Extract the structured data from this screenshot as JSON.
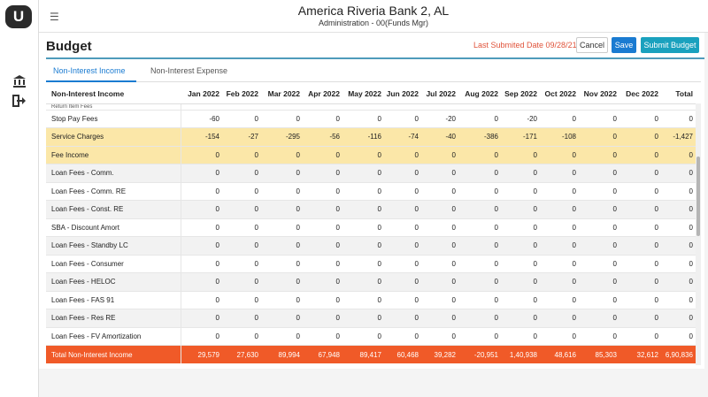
{
  "app": {
    "logo": "U"
  },
  "header": {
    "bank_name": "America Riveria Bank 2, AL",
    "subtitle": "Administration - 00(Funds Mgr)"
  },
  "page": {
    "title": "Budget",
    "last_submitted": "Last Submited Date 09/28/21",
    "cancel_label": "Cancel",
    "save_label": "Save",
    "submit_label": "Submit Budget"
  },
  "tabs": [
    {
      "label": "Non-Interest Income",
      "active": true
    },
    {
      "label": "Non-Interest Expense",
      "active": false
    }
  ],
  "table": {
    "columns": [
      "Non-Interest Income",
      "Jan 2022",
      "Feb 2022",
      "Mar 2022",
      "Apr 2022",
      "May 2022",
      "Jun 2022",
      "Jul 2022",
      "Aug 2022",
      "Sep 2022",
      "Oct 2022",
      "Nov 2022",
      "Dec 2022",
      "Total"
    ],
    "partial_row_label": "Return Item Fees",
    "rows": [
      {
        "label": "Stop Pay Fees",
        "values": [
          "-60",
          "0",
          "0",
          "0",
          "0",
          "0",
          "-20",
          "0",
          "-20",
          "0",
          "0",
          "0",
          "0"
        ],
        "highlight": false
      },
      {
        "label": "Service Charges",
        "values": [
          "-154",
          "-27",
          "-295",
          "-56",
          "-116",
          "-74",
          "-40",
          "-386",
          "-171",
          "-108",
          "0",
          "0",
          "-1,427"
        ],
        "highlight": true
      },
      {
        "label": "Fee Income",
        "values": [
          "0",
          "0",
          "0",
          "0",
          "0",
          "0",
          "0",
          "0",
          "0",
          "0",
          "0",
          "0",
          "0"
        ],
        "highlight": true
      },
      {
        "label": "Loan Fees - Comm.",
        "values": [
          "0",
          "0",
          "0",
          "0",
          "0",
          "0",
          "0",
          "0",
          "0",
          "0",
          "0",
          "0",
          "0"
        ],
        "highlight": false
      },
      {
        "label": "Loan Fees - Comm. RE",
        "values": [
          "0",
          "0",
          "0",
          "0",
          "0",
          "0",
          "0",
          "0",
          "0",
          "0",
          "0",
          "0",
          "0"
        ],
        "highlight": false
      },
      {
        "label": "Loan Fees - Const. RE",
        "values": [
          "0",
          "0",
          "0",
          "0",
          "0",
          "0",
          "0",
          "0",
          "0",
          "0",
          "0",
          "0",
          "0"
        ],
        "highlight": false
      },
      {
        "label": "SBA - Discount Amort",
        "values": [
          "0",
          "0",
          "0",
          "0",
          "0",
          "0",
          "0",
          "0",
          "0",
          "0",
          "0",
          "0",
          "0"
        ],
        "highlight": false
      },
      {
        "label": "Loan Fees - Standby LC",
        "values": [
          "0",
          "0",
          "0",
          "0",
          "0",
          "0",
          "0",
          "0",
          "0",
          "0",
          "0",
          "0",
          "0"
        ],
        "highlight": false
      },
      {
        "label": "Loan Fees - Consumer",
        "values": [
          "0",
          "0",
          "0",
          "0",
          "0",
          "0",
          "0",
          "0",
          "0",
          "0",
          "0",
          "0",
          "0"
        ],
        "highlight": false
      },
      {
        "label": "Loan Fees - HELOC",
        "values": [
          "0",
          "0",
          "0",
          "0",
          "0",
          "0",
          "0",
          "0",
          "0",
          "0",
          "0",
          "0",
          "0"
        ],
        "highlight": false
      },
      {
        "label": "Loan Fees - FAS 91",
        "values": [
          "0",
          "0",
          "0",
          "0",
          "0",
          "0",
          "0",
          "0",
          "0",
          "0",
          "0",
          "0",
          "0"
        ],
        "highlight": false
      },
      {
        "label": "Loan Fees - Res RE",
        "values": [
          "0",
          "0",
          "0",
          "0",
          "0",
          "0",
          "0",
          "0",
          "0",
          "0",
          "0",
          "0",
          "0"
        ],
        "highlight": false
      },
      {
        "label": "Loan Fees - FV Amortization",
        "values": [
          "0",
          "0",
          "0",
          "0",
          "0",
          "0",
          "0",
          "0",
          "0",
          "0",
          "0",
          "0",
          "0"
        ],
        "highlight": false
      }
    ],
    "total": {
      "label": "Total Non-Interest Income",
      "values": [
        "29,579",
        "27,630",
        "89,994",
        "67,948",
        "89,417",
        "60,468",
        "39,282",
        "-20,951",
        "1,40,938",
        "48,616",
        "85,303",
        "32,612",
        "6,90,836"
      ]
    }
  },
  "icons": {
    "menu": "hamburger-icon",
    "bank": "bank-icon",
    "logout": "logout-icon"
  },
  "colors": {
    "accent": "#1a7bd1",
    "submit": "#1aa1be",
    "highlight_row": "#fbe7a8",
    "total_row": "#f05a28",
    "last_submitted": "#e0533a"
  }
}
